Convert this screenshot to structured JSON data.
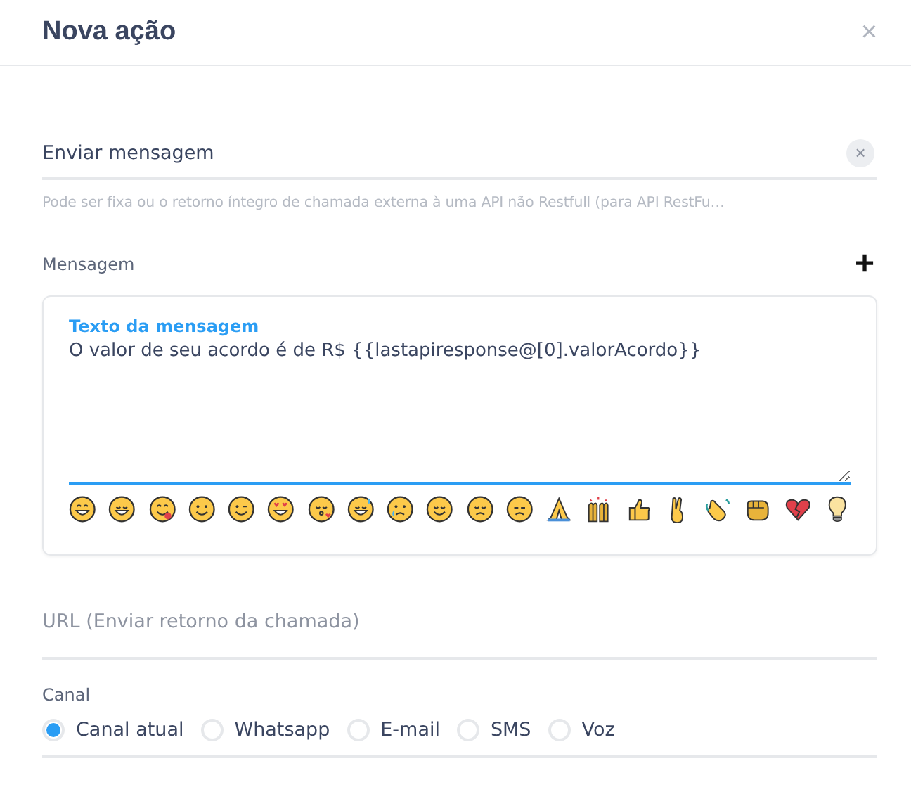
{
  "dialog": {
    "title": "Nova ação",
    "close": "×"
  },
  "action": {
    "value": "Enviar mensagem",
    "clear": "×",
    "hint": "Pode ser fixa ou o retorno íntegro de chamada externa à uma API não Restfull (para API RestFu…"
  },
  "message": {
    "label": "Mensagem",
    "add": "+",
    "field_label": "Texto da mensagem",
    "value": "O valor de seu acordo é de R$ {{lastapiresponse@[0].valorAcordo}}"
  },
  "url": {
    "placeholder": "URL (Enviar retorno da chamada)"
  },
  "channel": {
    "label": "Canal",
    "options": [
      {
        "label": "Canal atual",
        "selected": true
      },
      {
        "label": "Whatsapp",
        "selected": false
      },
      {
        "label": "E-mail",
        "selected": false
      },
      {
        "label": "SMS",
        "selected": false
      },
      {
        "label": "Voz",
        "selected": false
      }
    ]
  }
}
